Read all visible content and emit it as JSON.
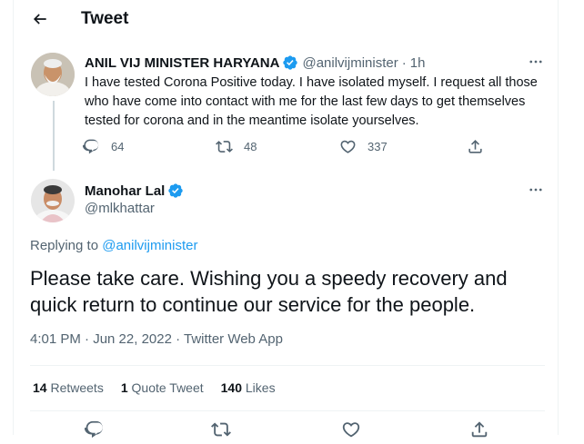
{
  "header": {
    "title": "Tweet"
  },
  "parent_tweet": {
    "author_name": "ANIL VIJ MINISTER HARYANA",
    "handle": "@anilvijminister",
    "separator": "·",
    "time": "1h",
    "text": "I have tested Corona Positive today. I have isolated myself. I request all those who have come into contact with me for the last few days to get themselves tested for corona and in the meantime isolate yourselves.",
    "replies": "64",
    "retweets": "48",
    "likes": "337"
  },
  "reply_tweet": {
    "author_name": "Manohar Lal",
    "handle": "@mlkhattar",
    "replying_prefix": "Replying to ",
    "replying_handle": "@anilvijminister",
    "text": "Please take care. Wishing you a speedy recovery and quick return to continue our service for the people.",
    "meta": "4:01 PM · Jun 22, 2022 · Twitter Web App",
    "retweets_count": "14",
    "retweets_label": " Retweets",
    "quote_count": "1",
    "quote_label": " Quote Tweet",
    "likes_count": "140",
    "likes_label": " Likes"
  },
  "colors": {
    "accent": "#1d9bf0",
    "secondary_text": "#536471",
    "primary_text": "#0f1419",
    "verified": "#1d9bf0"
  },
  "icons": [
    "back-arrow-icon",
    "verified-badge-icon",
    "more-icon",
    "reply-icon",
    "retweet-icon",
    "like-icon",
    "share-icon"
  ]
}
